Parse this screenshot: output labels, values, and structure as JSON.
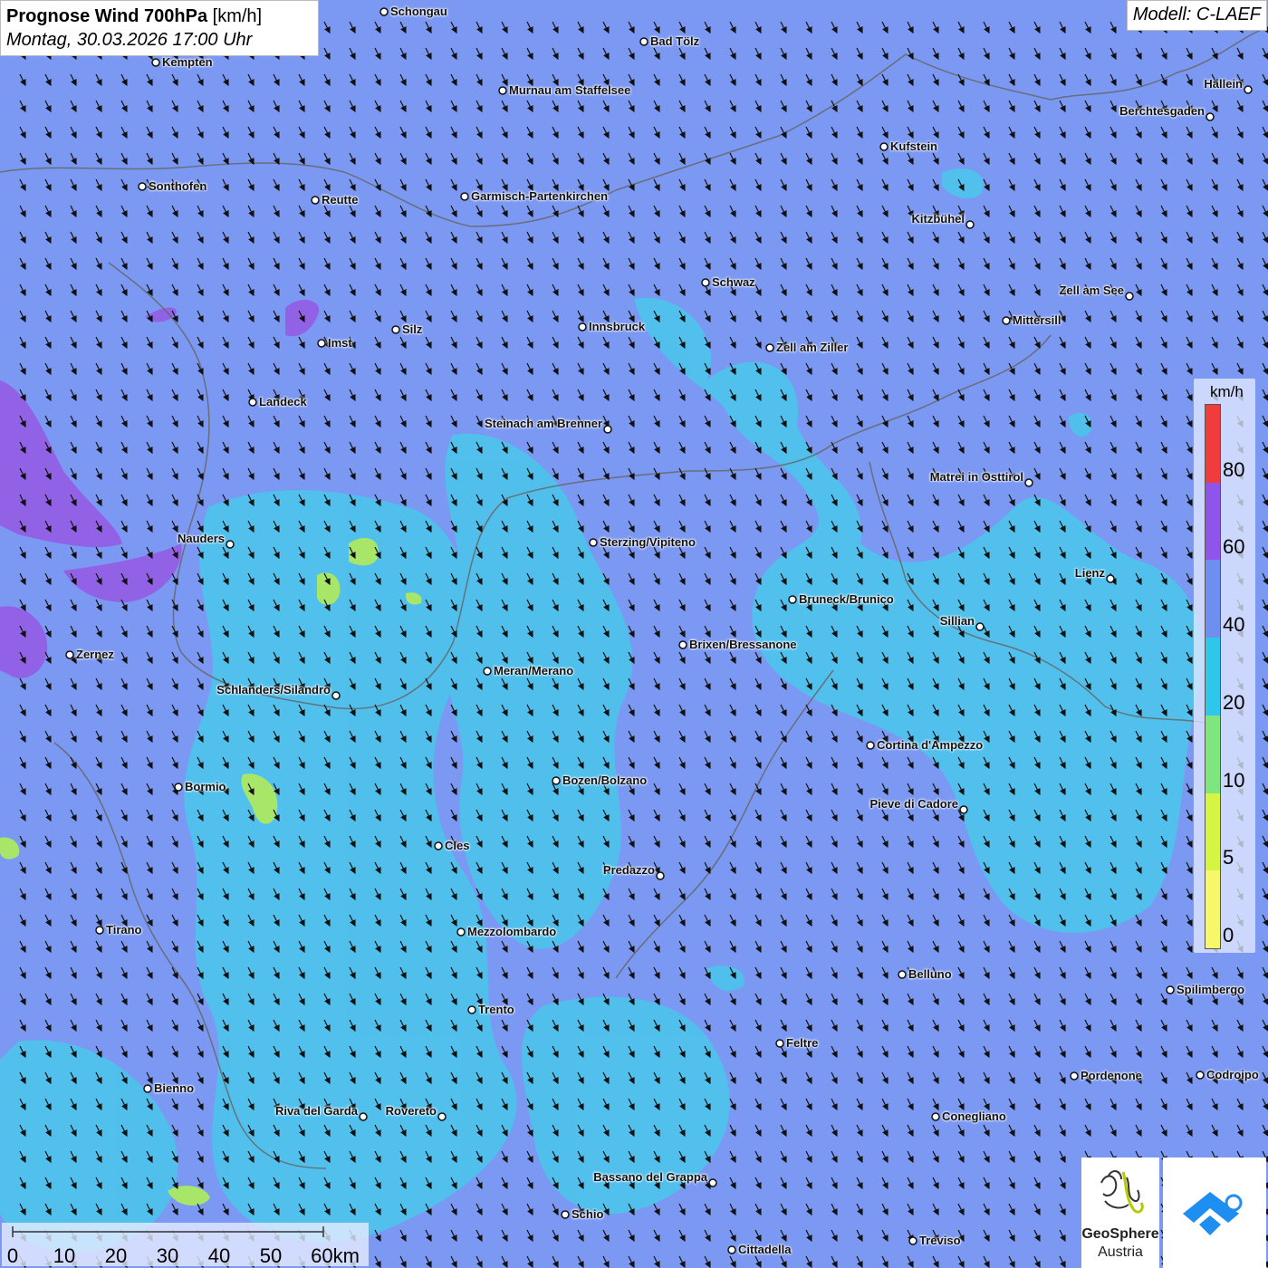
{
  "header": {
    "title_bold": "Prognose Wind 700hPa",
    "title_unit": "[km/h]",
    "datetime": "Montag, 30.03.2026 17:00 Uhr",
    "model": "Modell: C-LAEF"
  },
  "legend": {
    "unit": "km/h",
    "ticks": [
      "80",
      "60",
      "40",
      "20",
      "10",
      "5",
      "0"
    ],
    "colors": [
      "#f03c3c",
      "#8f55ea",
      "#6f8ff0",
      "#2ec6ea",
      "#7fe67e",
      "#d6f542",
      "#f7f76a"
    ]
  },
  "scale": {
    "labels": [
      "0",
      "10",
      "20",
      "30",
      "40",
      "50",
      "60km"
    ]
  },
  "logos": {
    "geosphere_line1": "GeoSphere",
    "geosphere_line2": "Austria",
    "icons": [
      "geosphere-logo-icon",
      "weather-app-icon"
    ]
  },
  "map_colors": {
    "background_wind": "#7b98f2",
    "light_wind": "#52c4ee",
    "calm": "#a6e46e",
    "strong": "#9360e6"
  },
  "cities": [
    {
      "name": "Schongau",
      "label_side": "right"
    },
    {
      "name": "Bad Tölz",
      "label_side": "right"
    },
    {
      "name": "Kempten",
      "label_side": "right"
    },
    {
      "name": "Murnau am Staffelsee",
      "label_side": "right"
    },
    {
      "name": "Hallein",
      "label_side": "left"
    },
    {
      "name": "Berchtesgaden",
      "label_side": "left"
    },
    {
      "name": "Kufstein",
      "label_side": "right"
    },
    {
      "name": "Sonthofen",
      "label_side": "right"
    },
    {
      "name": "Reutte",
      "label_side": "right"
    },
    {
      "name": "Garmisch-Partenkirchen",
      "label_side": "right"
    },
    {
      "name": "Kitzbühel",
      "label_side": "left"
    },
    {
      "name": "Schwaz",
      "label_side": "right"
    },
    {
      "name": "Zell am See",
      "label_side": "left"
    },
    {
      "name": "Innsbruck",
      "label_side": "right"
    },
    {
      "name": "Mittersill",
      "label_side": "right"
    },
    {
      "name": "Silz",
      "label_side": "right"
    },
    {
      "name": "Imst",
      "label_side": "right"
    },
    {
      "name": "Zell am Ziller",
      "label_side": "right"
    },
    {
      "name": "Landeck",
      "label_side": "right"
    },
    {
      "name": "Steinach am Brenner",
      "label_side": "left"
    },
    {
      "name": "Matrei in Osttirol",
      "label_side": "left"
    },
    {
      "name": "Nauders",
      "label_side": "left"
    },
    {
      "name": "Sterzing/Vipiteno",
      "label_side": "right"
    },
    {
      "name": "Lienz",
      "label_side": "left"
    },
    {
      "name": "Bruneck/Brunico",
      "label_side": "right"
    },
    {
      "name": "Sillian",
      "label_side": "left"
    },
    {
      "name": "Brixen/Bressanone",
      "label_side": "right"
    },
    {
      "name": "Zernez",
      "label_side": "right"
    },
    {
      "name": "Meran/Merano",
      "label_side": "right"
    },
    {
      "name": "Schlanders/Silandro",
      "label_side": "left"
    },
    {
      "name": "Cortina d'Ampezzo",
      "label_side": "right"
    },
    {
      "name": "Bozen/Bolzano",
      "label_side": "right"
    },
    {
      "name": "Bormio",
      "label_side": "right"
    },
    {
      "name": "Pieve di Cadore",
      "label_side": "left"
    },
    {
      "name": "Cles",
      "label_side": "right"
    },
    {
      "name": "Predazzo",
      "label_side": "left"
    },
    {
      "name": "Tirano",
      "label_side": "right"
    },
    {
      "name": "Mezzolombardo",
      "label_side": "right"
    },
    {
      "name": "Belluno",
      "label_side": "right"
    },
    {
      "name": "Spilimbergo",
      "label_side": "right"
    },
    {
      "name": "Trento",
      "label_side": "right"
    },
    {
      "name": "Feltre",
      "label_side": "right"
    },
    {
      "name": "Bienno",
      "label_side": "right"
    },
    {
      "name": "Pordenone",
      "label_side": "right"
    },
    {
      "name": "Codroipo",
      "label_side": "right"
    },
    {
      "name": "Riva del Garda",
      "label_side": "left"
    },
    {
      "name": "Rovereto",
      "label_side": "left"
    },
    {
      "name": "Conegliano",
      "label_side": "right"
    },
    {
      "name": "Bassano del Grappa",
      "label_side": "left"
    },
    {
      "name": "Schio",
      "label_side": "right"
    },
    {
      "name": "Treviso",
      "label_side": "right"
    },
    {
      "name": "Cittadella",
      "label_side": "right"
    }
  ]
}
